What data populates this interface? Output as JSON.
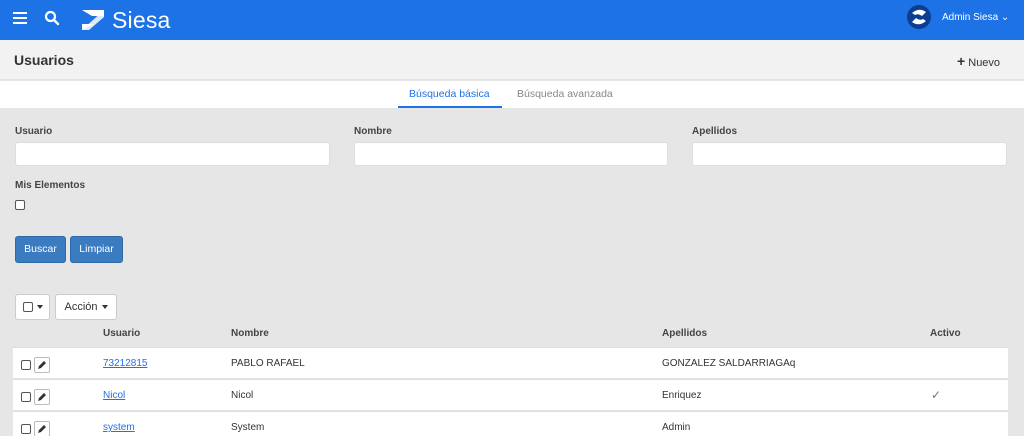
{
  "app": {
    "brand": "Siesa",
    "user_label": "Admin Siesa ⌄"
  },
  "header": {
    "title": "Usuarios",
    "new_label": "Nuevo"
  },
  "tabs": [
    {
      "label": "Búsqueda básica",
      "active": true
    },
    {
      "label": "Búsqueda avanzada",
      "active": false
    }
  ],
  "form": {
    "usuario_label": "Usuario",
    "nombre_label": "Nombre",
    "apellidos_label": "Apellidos",
    "mis_elementos_label": "Mis Elementos",
    "usuario_value": "",
    "nombre_value": "",
    "apellidos_value": "",
    "buscar_label": "Buscar",
    "limpiar_label": "Limpiar"
  },
  "toolbar": {
    "accion_label": "Acción"
  },
  "table": {
    "columns": [
      "Usuario",
      "Nombre",
      "Apellidos",
      "Activo"
    ],
    "rows": [
      {
        "usuario": "73212815",
        "nombre": "PABLO RAFAEL",
        "apellidos": "GONZALEZ SALDARRIAGAq",
        "activo": ""
      },
      {
        "usuario": "Nicol",
        "nombre": "Nicol",
        "apellidos": "Enriquez",
        "activo": "✓"
      },
      {
        "usuario": "system",
        "nombre": "System",
        "apellidos": "Admin",
        "activo": ""
      }
    ]
  },
  "colors": {
    "topbar": "#1d72e6",
    "primary_button": "#3b7bbf",
    "link": "#1d72e6",
    "background": "#e6e6e6"
  },
  "icons": [
    "menu-icon",
    "search-icon",
    "siesa-logo-icon",
    "user-avatar-icon",
    "plus-icon",
    "caret-down-icon",
    "pencil-icon",
    "checkmark-icon"
  ]
}
